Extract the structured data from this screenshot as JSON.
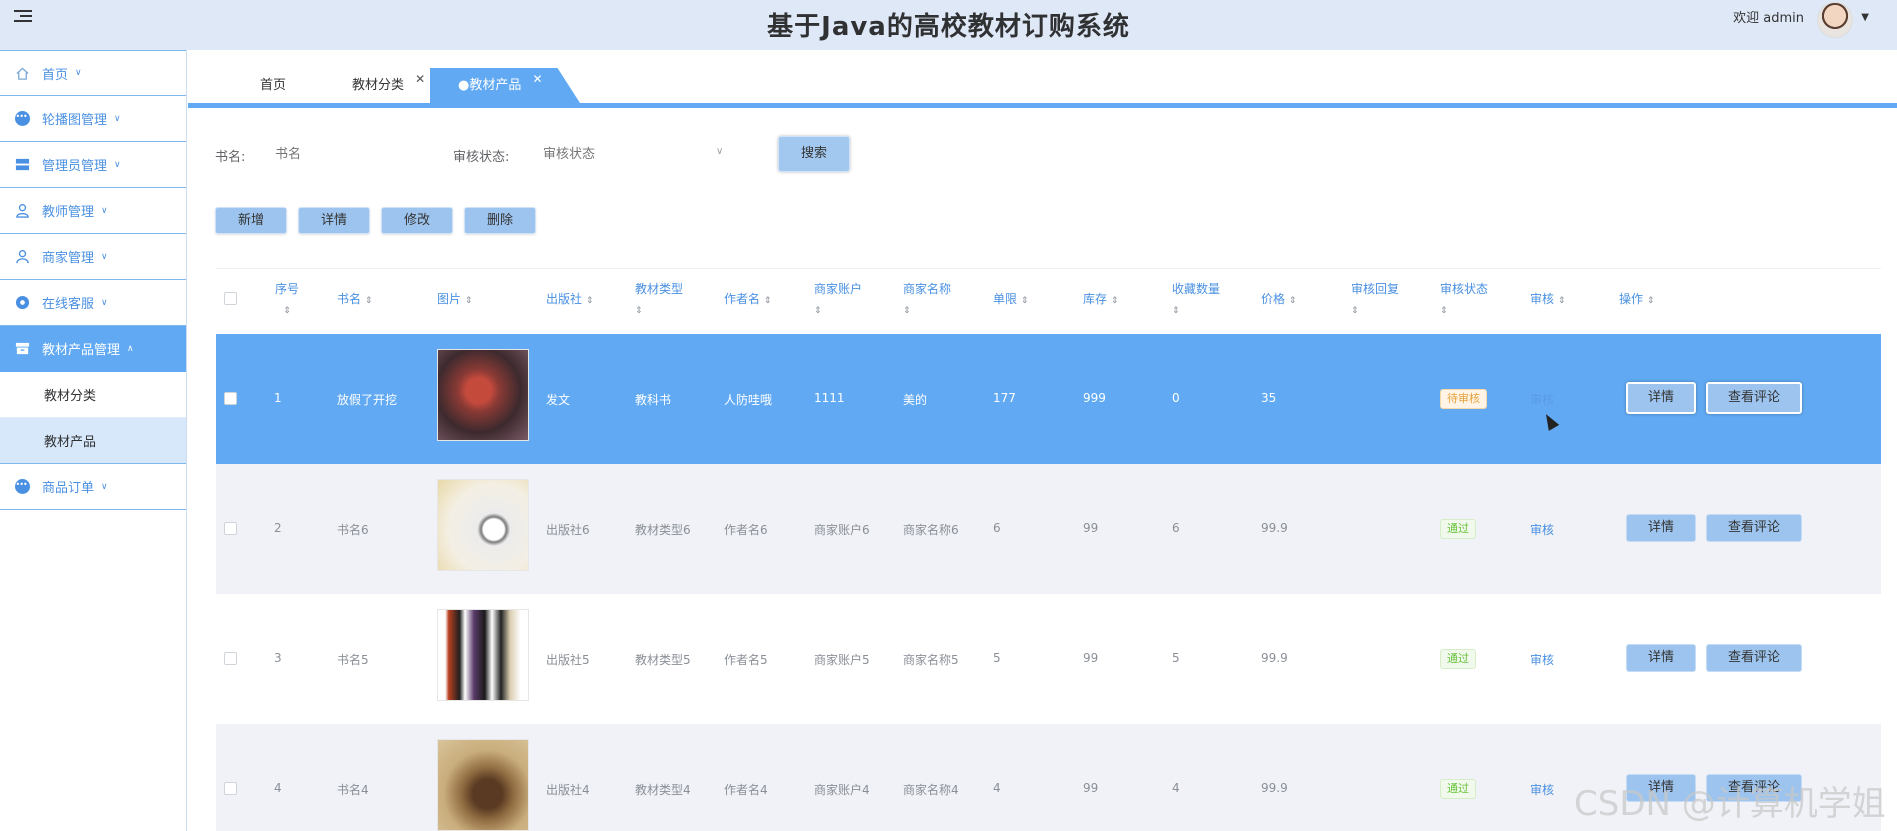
{
  "header": {
    "title": "基于Java的高校教材订购系统",
    "welcome": "欢迎 admin"
  },
  "sidebar": {
    "items": [
      {
        "label": "首页",
        "icon": "home-icon"
      },
      {
        "label": "轮播图管理",
        "icon": "more-circle-icon"
      },
      {
        "label": "管理员管理",
        "icon": "server-icon"
      },
      {
        "label": "教师管理",
        "icon": "teacher-icon"
      },
      {
        "label": "商家管理",
        "icon": "user-icon"
      },
      {
        "label": "在线客服",
        "icon": "service-icon"
      },
      {
        "label": "教材产品管理",
        "icon": "box-icon"
      },
      {
        "label": "商品订单",
        "icon": "more-circle-icon"
      }
    ],
    "subitems": [
      {
        "label": "教材分类"
      },
      {
        "label": "教材产品"
      }
    ]
  },
  "tabs": [
    {
      "label": "首页"
    },
    {
      "label": "教材分类"
    },
    {
      "label": "●教材产品"
    }
  ],
  "search": {
    "bookname_label": "书名:",
    "bookname_placeholder": "书名",
    "status_label": "审核状态:",
    "status_placeholder": "审核状态",
    "search_button": "搜索"
  },
  "actions": {
    "add": "新增",
    "detail": "详情",
    "edit": "修改",
    "delete": "删除"
  },
  "table": {
    "headers": [
      "序号",
      "书名",
      "图片",
      "出版社",
      "教材类型",
      "作者名",
      "商家账户",
      "商家名称",
      "单限",
      "库存",
      "收藏数量",
      "价格",
      "审核回复",
      "审核状态",
      "审核",
      "操作"
    ],
    "rows": [
      {
        "index": "1",
        "name": "放假了开挖",
        "publisher": "发文",
        "type": "教科书",
        "author": "人防哇哦",
        "account": "1111",
        "merchant": "美的",
        "limit": "177",
        "stock": "999",
        "favorites": "0",
        "price": "35",
        "reply": "",
        "status": "待审核",
        "audit": "审核",
        "detail": "详情",
        "comments": "查看评论"
      },
      {
        "index": "2",
        "name": "书名6",
        "publisher": "出版社6",
        "type": "教材类型6",
        "author": "作者名6",
        "account": "商家账户6",
        "merchant": "商家名称6",
        "limit": "6",
        "stock": "99",
        "favorites": "6",
        "price": "99.9",
        "reply": "",
        "status": "通过",
        "audit": "审核",
        "detail": "详情",
        "comments": "查看评论"
      },
      {
        "index": "3",
        "name": "书名5",
        "publisher": "出版社5",
        "type": "教材类型5",
        "author": "作者名5",
        "account": "商家账户5",
        "merchant": "商家名称5",
        "limit": "5",
        "stock": "99",
        "favorites": "5",
        "price": "99.9",
        "reply": "",
        "status": "通过",
        "audit": "审核",
        "detail": "详情",
        "comments": "查看评论"
      },
      {
        "index": "4",
        "name": "书名4",
        "publisher": "出版社4",
        "type": "教材类型4",
        "author": "作者名4",
        "account": "商家账户4",
        "merchant": "商家名称4",
        "limit": "4",
        "stock": "99",
        "favorites": "4",
        "price": "99.9",
        "reply": "",
        "status": "通过",
        "audit": "审核",
        "detail": "详情",
        "comments": "查看评论"
      }
    ]
  },
  "watermark": "CSDN @计算机学姐",
  "colors": {
    "accent": "#61aaf3",
    "header_bg": "#dfe8f7",
    "link": "#4a90e2"
  }
}
